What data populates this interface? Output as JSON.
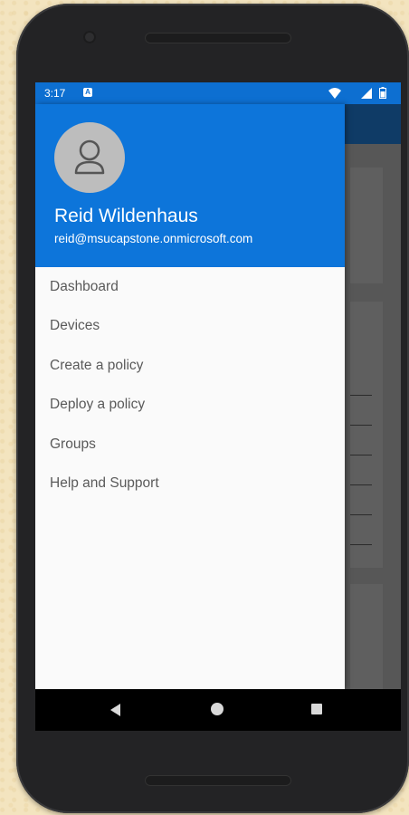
{
  "status_bar": {
    "time": "3:17",
    "notification_icon": "a-notification-icon",
    "wifi_icon": "wifi-icon",
    "signal_icon": "signal-icon",
    "battery_icon": "battery-icon"
  },
  "drawer": {
    "user_name": "Reid Wildenhaus",
    "user_email": "reid@msucapstone.onmicrosoft.com",
    "avatar_icon": "person-icon",
    "items": [
      {
        "label": "Dashboard"
      },
      {
        "label": "Devices"
      },
      {
        "label": "Create a policy"
      },
      {
        "label": "Deploy a policy"
      },
      {
        "label": "Groups"
      },
      {
        "label": "Help and Support"
      }
    ]
  },
  "nav_bar": {
    "back_icon": "back-triangle-icon",
    "home_icon": "home-circle-icon",
    "recents_icon": "recents-square-icon"
  },
  "colors": {
    "header_blue": "#0d75da",
    "status_blue": "#0d6fd1",
    "toolbar_dark": "#0f3b66",
    "menu_text": "#5a5a5a"
  }
}
